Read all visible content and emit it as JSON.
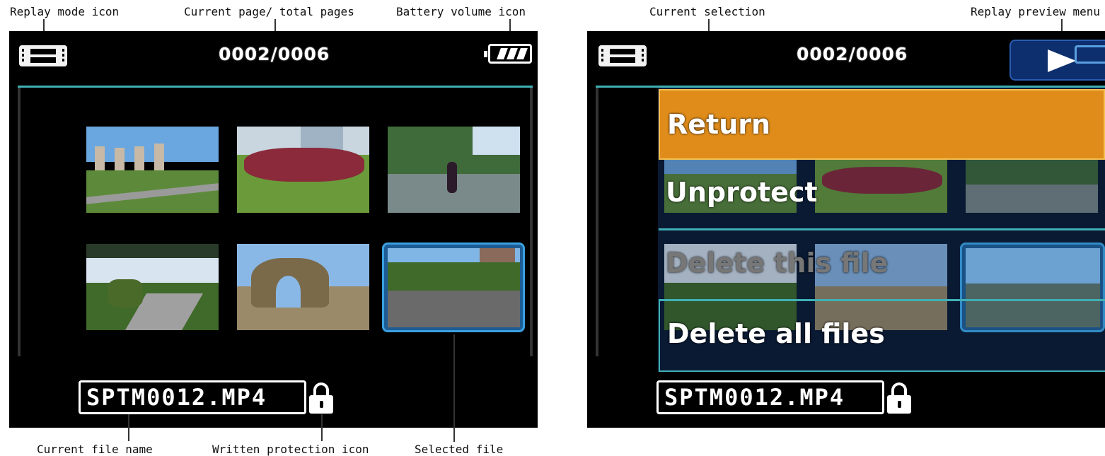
{
  "annotations": {
    "replay_mode": "Replay mode icon",
    "current_page": "Current page/ total pages",
    "battery": "Battery volume icon",
    "current_selection": "Current selection",
    "replay_preview_menu": "Replay preview menu",
    "file_name": "Current file name",
    "write_protection": "Written protection icon",
    "selected_file": "Selected file"
  },
  "left_screen": {
    "page_counter": "0002/0006",
    "file_name": "SPTM0012.MP4"
  },
  "right_screen": {
    "page_counter": "0002/0006",
    "file_name": "SPTM0012.MP4",
    "menu": [
      "Return",
      "Unprotect",
      "Delete this file",
      "Delete all files"
    ],
    "selected_index": 0
  },
  "thumbnails": [
    {
      "name": "thumb-buildings-park",
      "sky": "#6aa6e0",
      "ground": "#5c8a3a"
    },
    {
      "name": "thumb-red-plants",
      "sky": "#c9d6e0",
      "ground": "#6a9a3a"
    },
    {
      "name": "thumb-woman-railing",
      "sky": "#3f6a3a",
      "ground": "#7a8a8a"
    },
    {
      "name": "thumb-topiary-path",
      "sky": "#d8e4f0",
      "ground": "#8a8a7a"
    },
    {
      "name": "thumb-rock-arch",
      "sky": "#8ab8e6",
      "ground": "#9a8a6a"
    },
    {
      "name": "thumb-road-trees",
      "sky": "#7fb6e6",
      "ground": "#6a6a6a"
    }
  ],
  "colors": {
    "menu_selected": "#e08c1a",
    "menu_bg": "#0a1a33",
    "panel_line": "#3fb0b5",
    "selected_frame": "#3aa0e0"
  }
}
